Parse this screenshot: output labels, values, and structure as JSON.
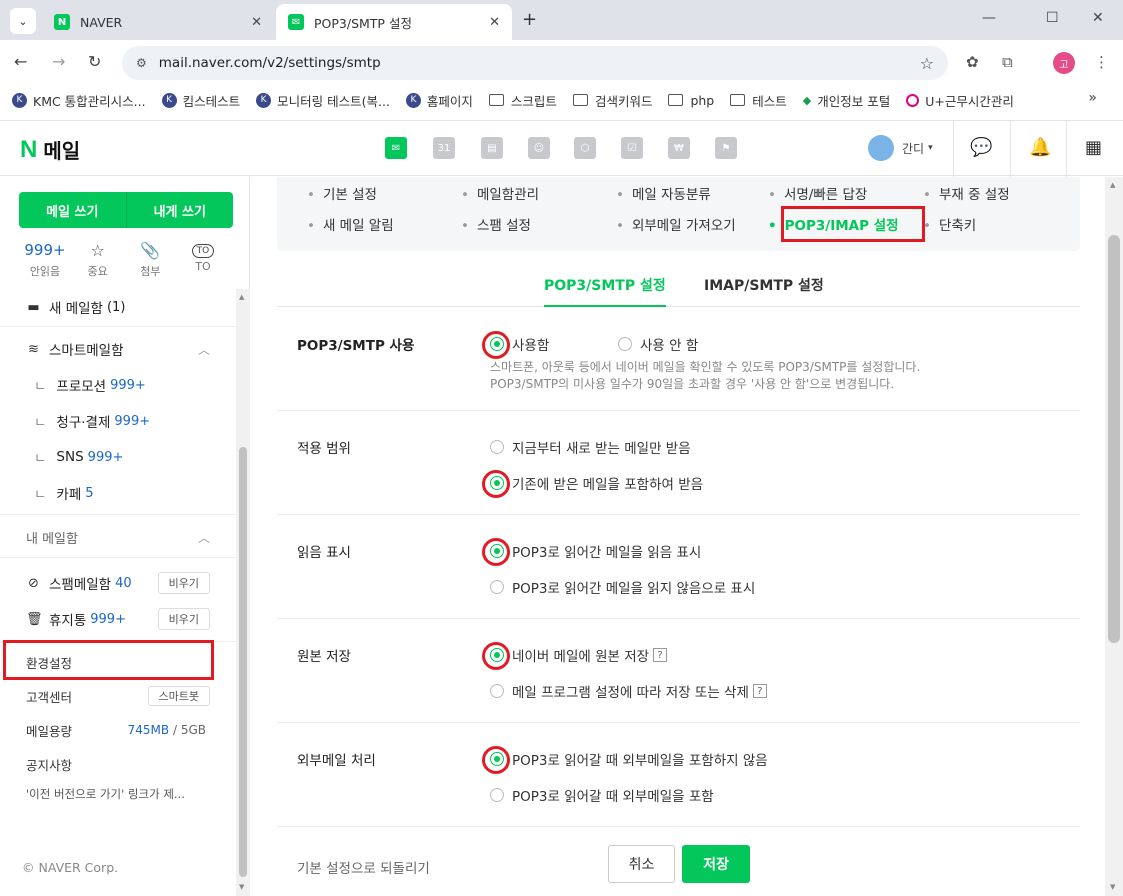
{
  "browser": {
    "tabs": [
      {
        "title": "NAVER",
        "favicon": "N"
      },
      {
        "title": "POP3/SMTP 설정",
        "favicon": "mail"
      }
    ],
    "url": "mail.naver.com/v2/settings/smtp",
    "profile_initial": "고",
    "bookmarks": [
      {
        "label": "KMC 통합관리시스...",
        "icon": "k-icon"
      },
      {
        "label": "킴스테스트",
        "icon": "k-icon"
      },
      {
        "label": "모니터링 테스트(복...",
        "icon": "k-icon"
      },
      {
        "label": "홈페이지",
        "icon": "k-icon"
      },
      {
        "label": "스크립트",
        "icon": "folder-icon"
      },
      {
        "label": "검색키워드",
        "icon": "folder-icon"
      },
      {
        "label": "php",
        "icon": "folder-icon"
      },
      {
        "label": "테스트",
        "icon": "folder-icon"
      },
      {
        "label": "개인정보 포털",
        "icon": "portal-icon"
      },
      {
        "label": "U+근무시간관리",
        "icon": "uplus-icon"
      }
    ]
  },
  "header": {
    "logo_n": "N",
    "logo_text": "메일",
    "calendar_day": "31",
    "user_name": "간디"
  },
  "sidebar": {
    "compose": "메일 쓰기",
    "compose_self": "내게 쓰기",
    "quick": [
      {
        "value": "999+",
        "label": "안읽음"
      },
      {
        "icon": "star-icon",
        "label": "중요"
      },
      {
        "icon": "paperclip-icon",
        "label": "첨부"
      },
      {
        "icon": "to-icon",
        "label": "TO"
      }
    ],
    "new_mail": {
      "label": "새 메일함",
      "count": "(1)"
    },
    "smart_mailbox": "스마트메일함",
    "smart_items": [
      {
        "label": "프로모션",
        "count": "999+"
      },
      {
        "label": "청구·결제",
        "count": "999+"
      },
      {
        "label": "SNS",
        "count": "999+"
      },
      {
        "label": "카페",
        "count": "5"
      }
    ],
    "my_mailbox": "내 메일함",
    "spam": {
      "label": "스팸메일함",
      "count": "40",
      "action": "비우기"
    },
    "trash": {
      "label": "휴지통",
      "count": "999+",
      "action": "비우기"
    },
    "settings": "환경설정",
    "support": {
      "label": "고객센터",
      "action": "스마트봇"
    },
    "capacity": {
      "label": "메일용량",
      "used": "745MB",
      "sep": "/",
      "total": "5GB"
    },
    "notice": "공지사항",
    "old_version": "'이전 버전으로 가기' 링크가 제...",
    "copyright": "© NAVER Corp."
  },
  "settings_menu": [
    {
      "label": "기본 설정"
    },
    {
      "label": "메일함관리"
    },
    {
      "label": "메일 자동분류"
    },
    {
      "label": "서명/빠른 답장"
    },
    {
      "label": "부재 중 설정"
    },
    {
      "label": "새 메일 알림"
    },
    {
      "label": "스팸 설정"
    },
    {
      "label": "외부메일 가져오기"
    },
    {
      "label": "POP3/IMAP 설정",
      "active": true
    },
    {
      "label": "단축키"
    }
  ],
  "subtabs": [
    {
      "label": "POP3/SMTP 설정",
      "active": true
    },
    {
      "label": "IMAP/SMTP 설정"
    }
  ],
  "sections": {
    "use": {
      "label": "POP3/SMTP 사용",
      "options": [
        "사용함",
        "사용 안 함"
      ],
      "selected": 0,
      "desc1": "스마트폰, 아웃룩 등에서 네이버 메일을 확인할 수 있도록 POP3/SMTP를 설정합니다.",
      "desc2": "POP3/SMTP의 미사용 일수가 90일을 초과할 경우 '사용 안 함'으로 변경됩니다."
    },
    "scope": {
      "label": "적용 범위",
      "options": [
        "지금부터 새로 받는 메일만 받음",
        "기존에 받은 메일을 포함하여 받음"
      ],
      "selected": 1
    },
    "read": {
      "label": "읽음 표시",
      "options": [
        "POP3로 읽어간 메일을 읽음 표시",
        "POP3로 읽어간 메일을 읽지 않음으로 표시"
      ],
      "selected": 0
    },
    "original": {
      "label": "원본 저장",
      "options": [
        "네이버 메일에 원본 저장",
        "메일 프로그램 설정에 따라 저장 또는 삭제"
      ],
      "selected": 0,
      "help": "?"
    },
    "external": {
      "label": "외부메일 처리",
      "options": [
        "POP3로 읽어갈 때 외부메일을 포함하지 않음",
        "POP3로 읽어갈 때 외부메일을 포함"
      ],
      "selected": 0
    }
  },
  "actions": {
    "reset": "기본 설정으로 되돌리기",
    "cancel": "취소",
    "save": "저장"
  },
  "colors": {
    "brand_green": "#03c75a",
    "highlight_red": "#e21b23",
    "link_blue": "#1a66c9"
  }
}
